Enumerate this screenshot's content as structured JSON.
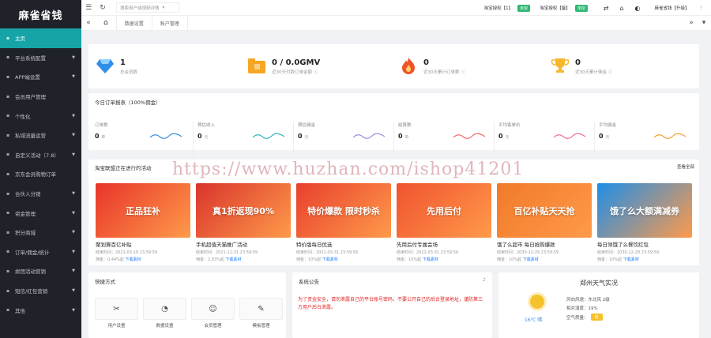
{
  "app": {
    "title": "麻雀省钱"
  },
  "sidebar": {
    "items": [
      {
        "label": "主页",
        "icon": "home-icon",
        "active": true
      },
      {
        "label": "平台系统配置",
        "icon": "settings-icon",
        "caret": true
      },
      {
        "label": "APP端设置",
        "icon": "app-icon",
        "caret": true
      },
      {
        "label": "会员用户管理",
        "icon": "user-icon",
        "caret": false
      },
      {
        "label": "个性化",
        "icon": "brush-icon",
        "caret": true
      },
      {
        "label": "私域流量运营",
        "icon": "traffic-icon",
        "caret": true
      },
      {
        "label": "自定义活动（7.8）",
        "icon": "activity-icon",
        "caret": true
      },
      {
        "label": "京东会员购物订单",
        "icon": "order-icon",
        "caret": false
      },
      {
        "label": "合伙人分销",
        "icon": "partner-icon",
        "caret": true
      },
      {
        "label": "资金管理",
        "icon": "money-icon",
        "caret": true
      },
      {
        "label": "积分商城",
        "icon": "mall-icon",
        "caret": true
      },
      {
        "label": "订单/佣金/统计",
        "icon": "chart-icon",
        "caret": true
      },
      {
        "label": "拼团活动营销",
        "icon": "group-icon",
        "caret": true
      },
      {
        "label": "短信/红包营销",
        "icon": "sms-icon",
        "caret": true
      },
      {
        "label": "其他",
        "icon": "more-icon",
        "caret": true
      }
    ]
  },
  "topbar": {
    "shop_placeholder": "搜索用户或视频详情",
    "auth1_label": "淘宝授权【1】",
    "auth1_badge": "未授",
    "auth2_label": "淘宝授权【备】",
    "auth2_badge": "未授",
    "user_label": "麻雀省钱【升级】"
  },
  "tabs": [
    {
      "label": "数据设置"
    },
    {
      "label": "账户管理"
    }
  ],
  "stats": [
    {
      "value": "1",
      "label": "总会员数",
      "icon": "diamond-icon",
      "color": "#2f8fe8"
    },
    {
      "value": "0 / 0.0GMV",
      "label": "近30天付款订单金额 ⓘ",
      "icon": "folder-icon",
      "color": "#f5a623"
    },
    {
      "value": "0",
      "label": "近30天累计订单数 ⓘ",
      "icon": "flame-icon",
      "color": "#f0522a"
    },
    {
      "value": "0",
      "label": "近30天累计佣金 ⓘ",
      "icon": "trophy-icon",
      "color": "#f5b72b"
    }
  ],
  "today": {
    "title": "今日订单报表（100%佣金）",
    "metrics": [
      {
        "label": "订单数",
        "value": "0",
        "unit": "单",
        "spark": "#2f8fe8"
      },
      {
        "label": "预估收入",
        "value": "0",
        "unit": "元",
        "spark": "#2eb8c4"
      },
      {
        "label": "预估佣金",
        "value": "0",
        "unit": "元",
        "spark": "#9b8be8"
      },
      {
        "label": "结算数",
        "value": "0",
        "unit": "单",
        "spark": "#f06a6a"
      },
      {
        "label": "平均客单价",
        "value": "0",
        "unit": "元",
        "spark": "#f06a9b"
      },
      {
        "label": "平均佣金",
        "value": "0",
        "unit": "元",
        "spark": "#f0a02a"
      }
    ]
  },
  "promos": {
    "title": "淘宝联盟正在进行的活动",
    "view_all": "查看全部",
    "items": [
      {
        "banner": "正品狂补",
        "banner_sub": "聚划算百亿补贴",
        "title": "聚划算百亿补贴",
        "time": "结束时间：2021-03-19 23:59:59",
        "rate": "佣金：0.44%起",
        "action": "下载素材",
        "bg": "#e8352a"
      },
      {
        "banner": "真1折返现90%",
        "banner_sub": "",
        "title": "手机超值天猫推广活动",
        "time": "结束时间：2021-12-31 23:59:59",
        "rate": "佣金：2.93%起",
        "action": "下载素材",
        "bg": "#d9342b"
      },
      {
        "banner": "特价爆款 限时秒杀",
        "banner_sub": "",
        "title": "特价版每日优选",
        "time": "结束时间：2021-03-31 23:59:59",
        "rate": "佣金：10%起",
        "action": "下载素材",
        "bg": "#e8402d"
      },
      {
        "banner": "先用后付",
        "banner_sub": "",
        "title": "先用后付专属会场",
        "time": "结束时间：2021-03-31 23:59:59",
        "rate": "佣金：10%起",
        "action": "下载素材",
        "bg": "#f0532f"
      },
      {
        "banner": "百亿补贴天天抢",
        "banner_sub": "",
        "title": "饿了么超市 每日抢购爆款",
        "time": "结束时间：2030-12-29 23:59:59",
        "rate": "佣金：10%起",
        "action": "下载素材",
        "bg": "#f07a2a"
      },
      {
        "banner": "饿了么大额满减券",
        "banner_sub": "",
        "title": "每日领饿了么餐饮红包",
        "time": "结束时间：2030-12-28 23:59:59",
        "rate": "佣金：10%起",
        "action": "下载素材",
        "bg": "#1e8ee8"
      }
    ]
  },
  "quick": {
    "title": "快捷方式",
    "tools": [
      {
        "label": "用户设置",
        "icon": "tools-icon"
      },
      {
        "label": "数据设置",
        "icon": "gauge-icon"
      },
      {
        "label": "会员管理",
        "icon": "member-icon"
      },
      {
        "label": "模板管理",
        "icon": "template-icon"
      }
    ]
  },
  "notice": {
    "title": "系统公告",
    "text": "为了资金安全，请勿泄露自己的平台账号密码，不要公开自己的后台登录地址，谨防第三方用户后台泄露。",
    "color": "#e02020"
  },
  "weather": {
    "title": "郑州天气实况",
    "temp": "16℃ 晴",
    "wind": "风向风速：东北风 2级",
    "humidity": "相对湿度：19%",
    "air": "空气质量：",
    "air_badge": "良"
  },
  "watermark": "https://www.huzhan.com/ishop41201"
}
